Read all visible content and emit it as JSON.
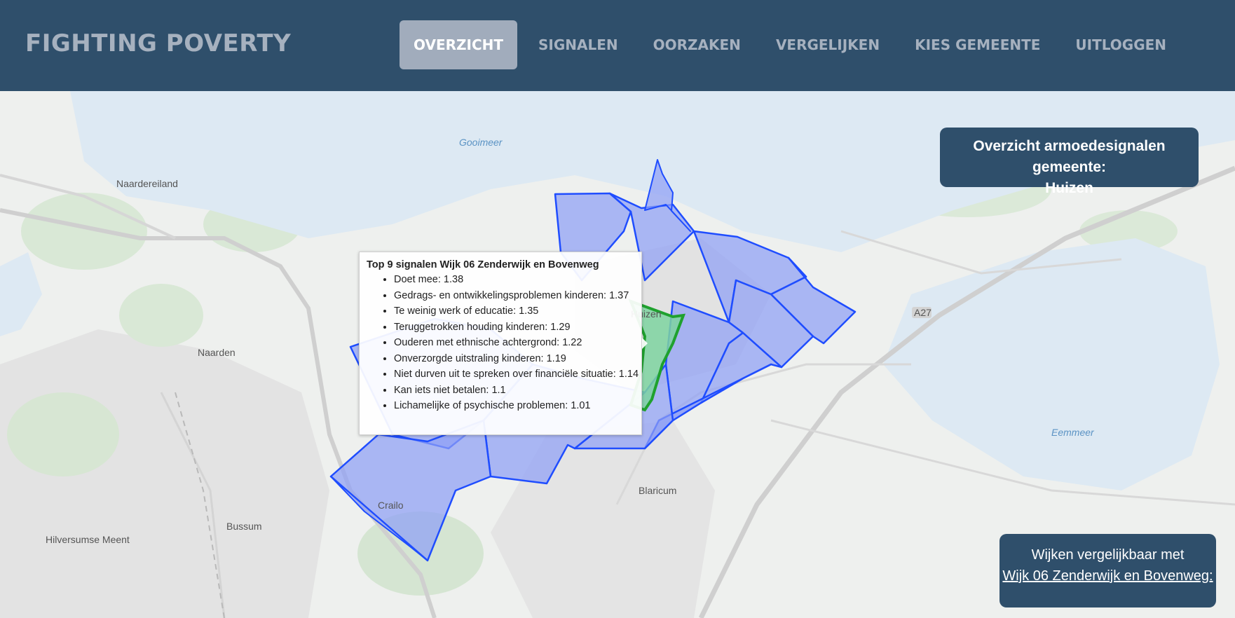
{
  "header": {
    "brand": "FIGHTING POVERTY",
    "nav": [
      {
        "label": "OVERZICHT",
        "active": true
      },
      {
        "label": "SIGNALEN",
        "active": false
      },
      {
        "label": "OORZAKEN",
        "active": false
      },
      {
        "label": "VERGELIJKEN",
        "active": false
      },
      {
        "label": "KIES GEMEENTE",
        "active": false
      },
      {
        "label": "UITLOGGEN",
        "active": false
      }
    ]
  },
  "info_panel": {
    "line1": "Overzicht armoedesignalen gemeente:",
    "line2": "Huizen"
  },
  "compare_panel": {
    "line1": "Wijken vergelijkbaar met",
    "link": "Wijk 06 Zenderwijk en Bovenweg:"
  },
  "tooltip": {
    "title": "Top 9 signalen Wijk 06 Zenderwijk en Bovenweg",
    "items": [
      "Doet mee: 1.38",
      "Gedrags- en ontwikkelingsproblemen kinderen: 1.37",
      "Te weinig werk of educatie: 1.35",
      "Teruggetrokken houding kinderen: 1.29",
      "Ouderen met ethnische achtergrond: 1.22",
      "Onverzorgde uitstraling kinderen: 1.19",
      "Niet durven uit te spreken over financiële situatie: 1.14",
      "Kan iets niet betalen: 1.1",
      "Lichamelijke of psychische problemen: 1.01"
    ]
  },
  "map": {
    "place_labels": [
      "Naardereiland",
      "Naarden",
      "Crailo",
      "Bussum",
      "Hilversumse Meent",
      "Blaricum",
      "Huizen"
    ],
    "water_labels": [
      "Gooimeer",
      "Eemmeer"
    ],
    "road_labels": [
      "A27"
    ],
    "colors": {
      "district_fill": "#8f9ff5",
      "district_stroke": "#1f4dff",
      "selected_fill": "#7ed3a0",
      "selected_stroke": "#1fa12e",
      "water": "#dde9f3",
      "land": "#eef0ee",
      "urban": "#e2e2e2"
    }
  }
}
